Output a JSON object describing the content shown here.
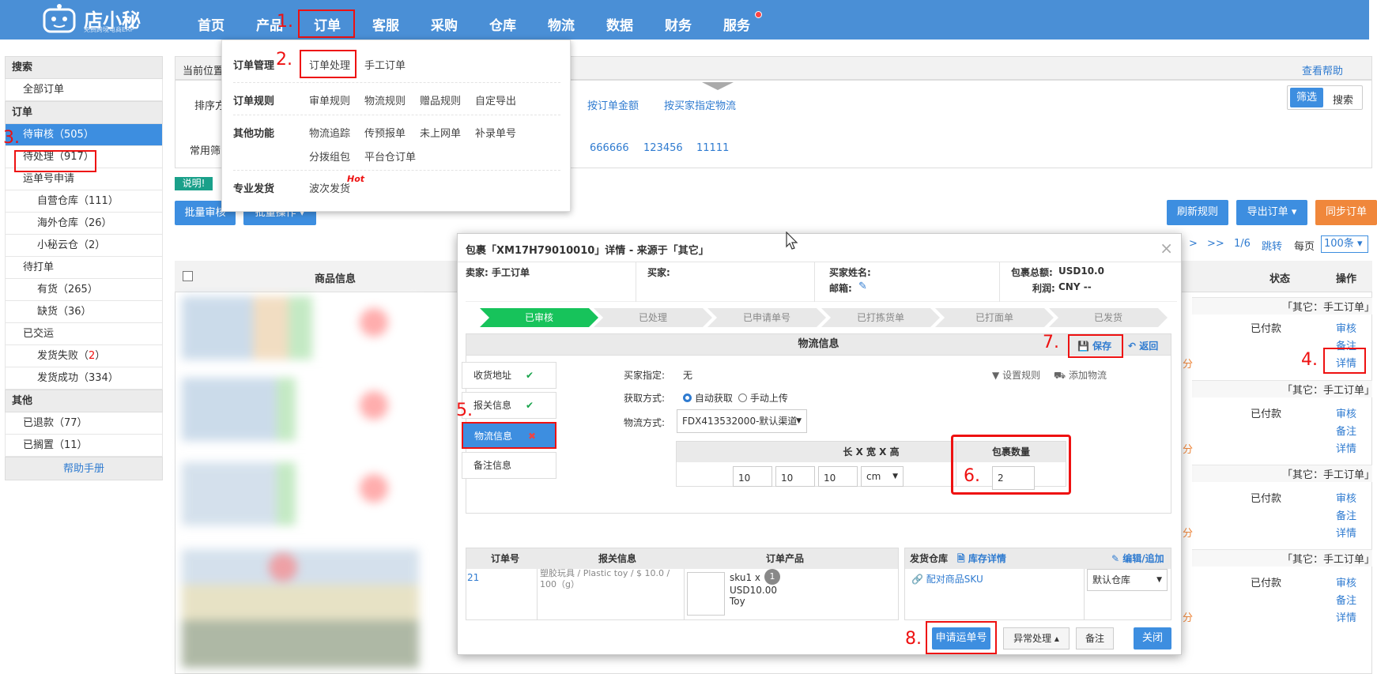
{
  "brand": {
    "name": "店小秘",
    "tagline": "免费跨境电商ERP"
  },
  "nav": {
    "items": [
      "首页",
      "产品",
      "订单",
      "客服",
      "采购",
      "仓库",
      "物流",
      "数据",
      "财务",
      "服务"
    ]
  },
  "annotations": [
    "1.",
    "2.",
    "3.",
    "4.",
    "5.",
    "6.",
    "7.",
    "8."
  ],
  "dropdown": {
    "cat_manage": "订单管理",
    "order_process": "订单处理",
    "manual_order": "手工订单",
    "cat_rules": "订单规则",
    "rule_links": [
      "审单规则",
      "物流规则",
      "赠品规则",
      "自定导出"
    ],
    "cat_other": "其他功能",
    "other_links_row1": [
      "物流追踪",
      "传预报单",
      "未上网单",
      "补录单号"
    ],
    "other_links_row2": [
      "分拨组包",
      "平台仓订单"
    ],
    "cat_pro": "专业发货",
    "batch_ship": "波次发货",
    "hot": "Hot"
  },
  "sidebar": {
    "search_head": "搜索",
    "all_orders": "全部订单",
    "order_head": "订单",
    "pending_review": "待审核（505）",
    "pending_process": "待处理（917）",
    "tracking_apply": "运单号申请",
    "own_wh": "自营仓库（111）",
    "overseas_wh": "海外仓库（26）",
    "xm_cloud": "小秘云仓（2）",
    "to_print": "待打单",
    "in_stock": "有货（265）",
    "out_stock": "缺货（36）",
    "shipped": "已交运",
    "ship_fail_label": "发货失败（",
    "ship_fail_num": "2",
    "ship_fail_close": "）",
    "ship_ok": "发货成功（334）",
    "other_head": "其他",
    "refunded": "已退款（77）",
    "shelved": "已搁置（11）",
    "help": "帮助手册"
  },
  "main": {
    "location_label": "当前位置",
    "view_help": "查看帮助",
    "sort_label": "排序方",
    "sort_links": [
      "按订单金额",
      "按买家指定物流"
    ],
    "filter_btn": "筛选",
    "search_btn": "搜索",
    "common_filter": "常用筛",
    "filter_tags": [
      "666666",
      "123456",
      "11111"
    ],
    "note_badge": "说明!",
    "batch_review": "批量审核",
    "batch_ops": "批量操作",
    "refresh_rules": "刷新规则",
    "export_orders": "导出订单",
    "sync_orders": "同步订单",
    "pager": {
      "next": ">",
      "last": ">>",
      "page": "1/6",
      "jump": "跳转",
      "per_page": "每页",
      "per_page_value": "100条"
    },
    "col_product": "商品信息",
    "col_status": "状态",
    "col_ops": "操作",
    "rows": [
      {
        "source": "「其它：手工订单」",
        "status": "已付款",
        "ops": [
          "审核",
          "备注",
          "详情"
        ]
      },
      {
        "source": "「其它：手工订单」",
        "status": "已付款",
        "ops": [
          "审核",
          "备注",
          "详情"
        ]
      },
      {
        "source": "「其它：手工订单」",
        "status": "已付款",
        "ops": [
          "审核",
          "备注",
          "详情"
        ]
      },
      {
        "source": "「其它：手工订单」",
        "status": "已付款",
        "ops": [
          "审核",
          "备注",
          "详情"
        ]
      }
    ],
    "fen": "分"
  },
  "modal": {
    "title": "包裹「XM17H79010010」详情 - 来源于「其它」",
    "close": "×",
    "seller": "卖家: 手工订单",
    "buyer": "买家:",
    "buyer_name": "买家姓名:",
    "email": "邮箱:",
    "total_label": "包裹总额:",
    "total_value": "USD10.0",
    "profit_label": "利润:",
    "profit_value": "CNY --",
    "steps": [
      "已审核",
      "已处理",
      "已申请单号",
      "已打拣货单",
      "已打面单",
      "已发货"
    ],
    "section_title": "物流信息",
    "save": "保存",
    "back": "返回",
    "tabs": [
      "收货地址",
      "报关信息",
      "物流信息",
      "备注信息"
    ],
    "buyer_assign_label": "买家指定:",
    "buyer_assign_value": "无",
    "set_rules": "设置规则",
    "add_logistics": "添加物流",
    "obtain_label": "获取方式:",
    "auto_get": "自动获取",
    "manual_upload": "手动上传",
    "method_label": "物流方式:",
    "method_value": "FDX413532000-默认渠道",
    "dim_header": "长 X 宽 X 高",
    "dims": [
      "10",
      "10",
      "10"
    ],
    "unit": "cm",
    "pkg_qty_label": "包裹数量",
    "pkg_qty": "2",
    "tbl_order_no": "订单号",
    "tbl_customs": "报关信息",
    "tbl_product": "订单产品",
    "order_no": "21",
    "customs_text": "塑胶玩具 / Plastic toy / $ 10.0 / 100（g）",
    "sku": "sku1 x",
    "sku_qty": "1",
    "price": "USD10.00",
    "product_name": "Toy",
    "ship_wh": "发货仓库",
    "stock_detail": "库存详情",
    "edit_add": "编辑/追加",
    "match_sku": "配对商品SKU",
    "default_wh": "默认仓库",
    "apply_tracking": "申请运单号",
    "exception": "异常处理",
    "remark": "备注",
    "close_btn": "关闭"
  },
  "colors": {
    "nav": "#4a8fd6",
    "accent": "#3d8ee0",
    "orange": "#f0873b",
    "annotation": "#e11111",
    "done": "#17c35b"
  }
}
